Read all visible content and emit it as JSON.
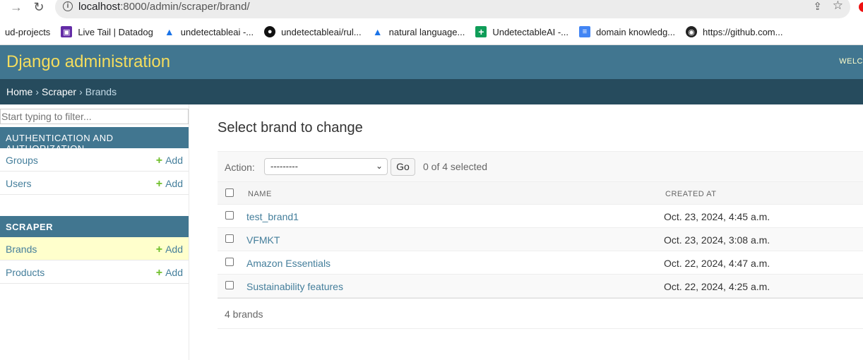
{
  "browser": {
    "url_host": "localhost",
    "url_path": ":8000/admin/scraper/brand/",
    "bookmarks": [
      {
        "label": "ud-projects",
        "icon": "none"
      },
      {
        "label": "Live Tail | Datadog",
        "icon": "datadog-icon"
      },
      {
        "label": "undetectableai -...",
        "icon": "google-drive-icon"
      },
      {
        "label": "undetectableai/rul...",
        "icon": "github-icon"
      },
      {
        "label": "natural language...",
        "icon": "google-drive-icon"
      },
      {
        "label": "UndetectableAI -...",
        "icon": "google-sheets-icon"
      },
      {
        "label": "domain knowledg...",
        "icon": "google-docs-icon"
      },
      {
        "label": "https://github.com...",
        "icon": "globe-icon"
      }
    ]
  },
  "header": {
    "branding": "Django administration",
    "welcome": "WELC"
  },
  "breadcrumbs": {
    "home": "Home",
    "app": "Scraper",
    "current": "Brands",
    "separator": "›"
  },
  "sidebar": {
    "filter_placeholder": "Start typing to filter...",
    "auth": {
      "caption": "AUTHENTICATION AND AUTHORIZATION",
      "items": [
        {
          "label": "Groups",
          "add": "Add"
        },
        {
          "label": "Users",
          "add": "Add"
        }
      ]
    },
    "scraper": {
      "caption": "SCRAPER",
      "items": [
        {
          "label": "Brands",
          "add": "Add"
        },
        {
          "label": "Products",
          "add": "Add"
        }
      ]
    }
  },
  "content": {
    "title": "Select brand to change",
    "action_label": "Action:",
    "action_selected": "---------",
    "go_label": "Go",
    "selected_count": "0 of 4 selected",
    "columns": {
      "name": "NAME",
      "created": "CREATED AT"
    },
    "rows": [
      {
        "name": "test_brand1",
        "created": "Oct. 23, 2024, 4:45 a.m."
      },
      {
        "name": "VFMKT",
        "created": "Oct. 23, 2024, 3:08 a.m."
      },
      {
        "name": "Amazon Essentials",
        "created": "Oct. 22, 2024, 4:47 a.m."
      },
      {
        "name": "Sustainability features",
        "created": "Oct. 22, 2024, 4:25 a.m."
      }
    ],
    "paginator": "4 brands"
  },
  "colors": {
    "header_bg": "#417690",
    "breadcrumb_bg": "#264b5d",
    "branding": "#f5dd5d",
    "link": "#447e9b",
    "add_plus": "#70bf2b",
    "active_row": "#ffffcc"
  }
}
